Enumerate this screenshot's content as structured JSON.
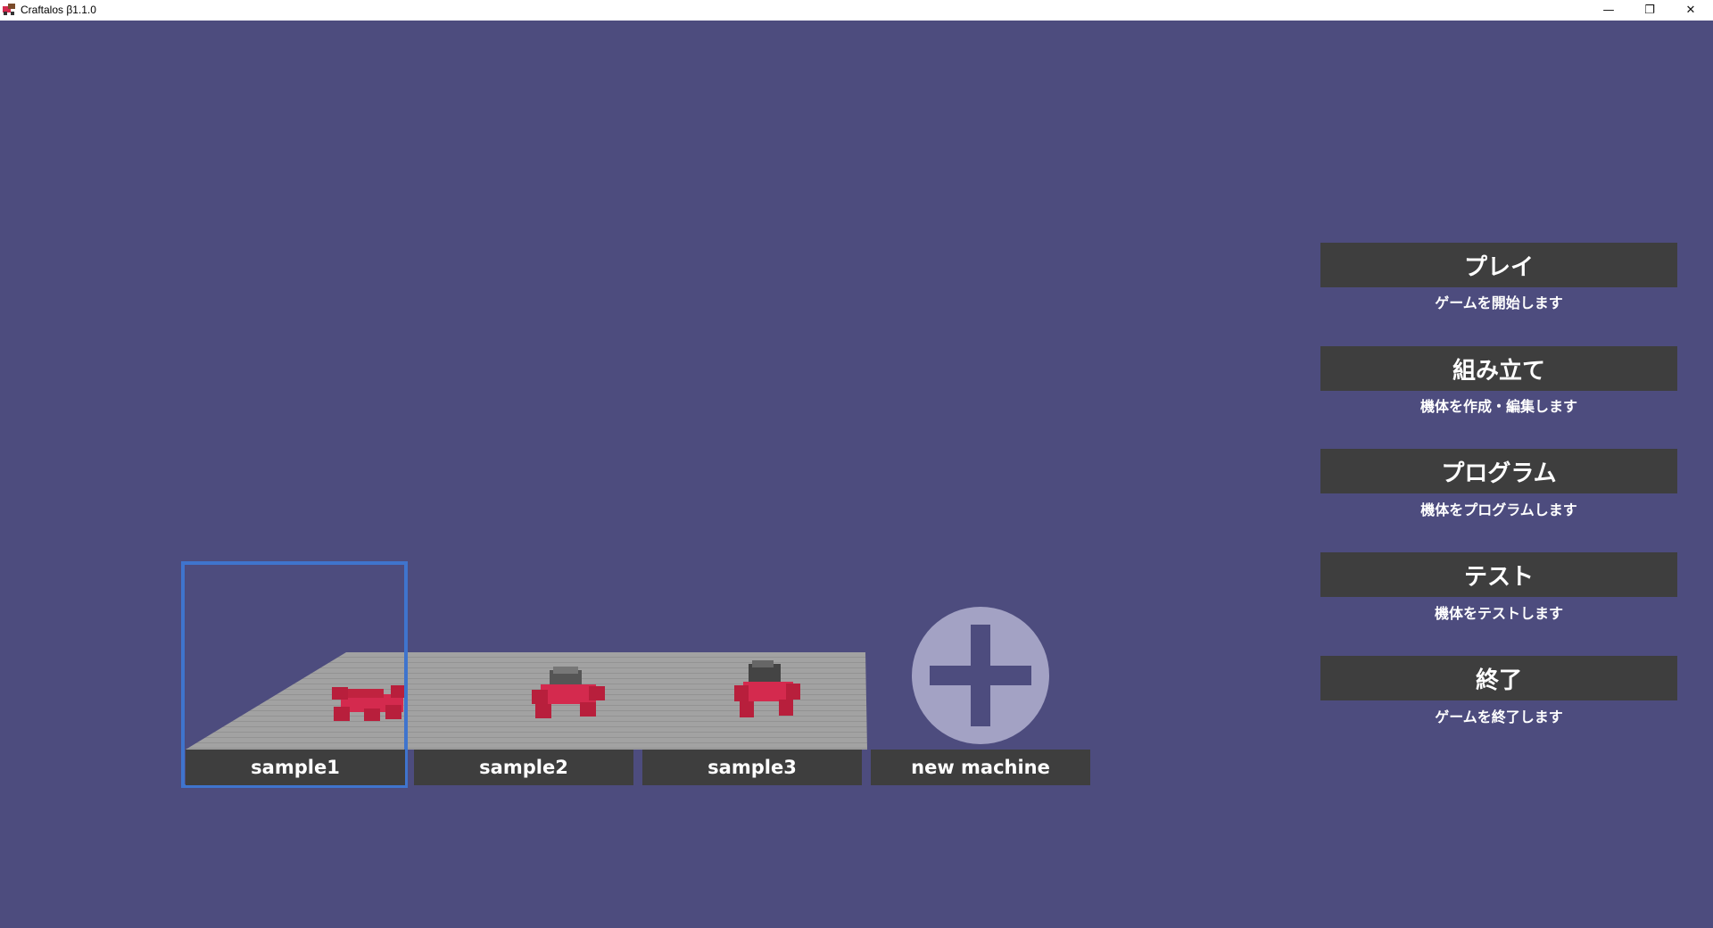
{
  "window": {
    "title": "Craftalos β1.1.0",
    "minimize": "—",
    "maximize": "❐",
    "close": "✕"
  },
  "machines": [
    {
      "label": "sample1",
      "selected": true
    },
    {
      "label": "sample2",
      "selected": false
    },
    {
      "label": "sample3",
      "selected": false
    },
    {
      "label": "new machine",
      "icon": "plus-icon"
    }
  ],
  "menu": [
    {
      "label": "プレイ",
      "description": "ゲームを開始します"
    },
    {
      "label": "組み立て",
      "description": "機体を作成・編集します"
    },
    {
      "label": "プログラム",
      "description": "機体をプログラムします"
    },
    {
      "label": "テスト",
      "description": "機体をテストします"
    },
    {
      "label": "終了",
      "description": "ゲームを終了します"
    }
  ],
  "colors": {
    "background": "#4d4c7e",
    "button": "#3e3e3e",
    "selection": "#3f74cd",
    "floor": "#a0a0a0",
    "car_body": "#d42a4e",
    "add_circle": "#a3a2c4"
  }
}
